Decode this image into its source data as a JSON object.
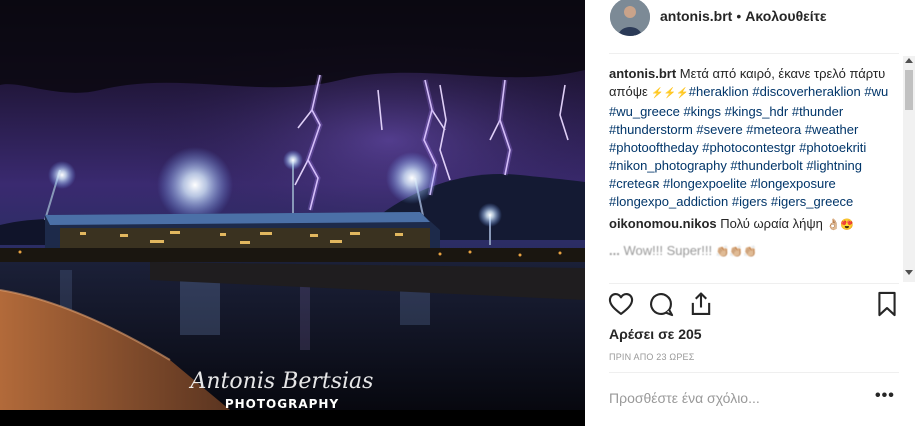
{
  "post": {
    "username": "antonis.brt",
    "separator": "•",
    "follow_status": "Ακολουθείτε",
    "watermark_line1": "Antonis Bertsias",
    "watermark_line2": "PHOTOGRAPHY"
  },
  "caption": {
    "username": "antonis.brt",
    "text": "Μετά από καιρό, έκανε τρελό πάρτυ απόψε",
    "emoji": "⚡⚡⚡",
    "hashtags": "#heraklion #discoverheraklion #wu #wu_greece #kings #kings_hdr #thunder #thunderstorm #severe #meteora #weather #photooftheday #photocontestgr #photoekriti #nikon_photography #thunderbolt #lightning #creteɢʀ #longexpoelite #longexposure #longexpo_addiction #igers #igers_greece"
  },
  "comments": [
    {
      "username": "oikonomou.nikos",
      "text": "Πολύ ωραία λήψη",
      "emoji": "👌🏼😍"
    },
    {
      "username": "...",
      "text": "Wow!!! Super!!!",
      "emoji": "👏🏼👏🏼👏🏼"
    }
  ],
  "likes": {
    "text": "Αρέσει σε 205"
  },
  "timestamp": "ΠΡΙΝ ΑΠΟ 23 ΩΡΕΣ",
  "comment_box": {
    "placeholder": "Προσθέστε ένα σχόλιο...",
    "more_label": "•••"
  },
  "icons": {
    "like": "heart-icon",
    "comment": "comment-bubble-icon",
    "share": "share-icon",
    "save": "bookmark-icon",
    "more": "more-options-icon"
  },
  "colors": {
    "text": "#262626",
    "hashtag": "#003569",
    "muted": "#999999",
    "divider": "#efefef"
  }
}
